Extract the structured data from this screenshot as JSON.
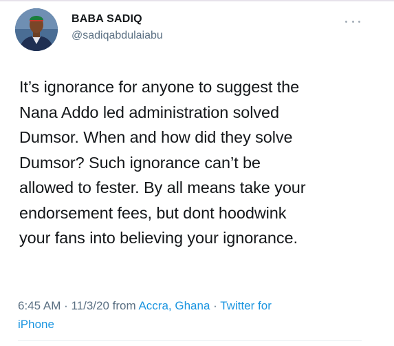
{
  "user": {
    "display_name": "BABA SADIQ",
    "handle": "@sadiqabdulaiabu",
    "avatar_icon": "profile-photo"
  },
  "menu_icon": "more-horizontal-icon",
  "tweet": {
    "lines": [
      "It’s ignorance for anyone to suggest the",
      "Nana Addo led administration solved",
      "Dumsor. When and how did they solve",
      "Dumsor? Such ignorance can’t be",
      "allowed to fester. By all means take your",
      "endorsement fees, but dont hoodwink",
      "your fans into believing your ignorance."
    ]
  },
  "meta": {
    "time": "6:45 AM",
    "separator1": " · ",
    "date": "11/3/20",
    "from_text": " from ",
    "location": "Accra, Ghana",
    "separator2": " · ",
    "source_part1": "Twitter for",
    "source_part2": "iPhone"
  },
  "colors": {
    "link": "#1b95e0",
    "secondary_text": "#5b7083",
    "primary_text": "#14171a"
  }
}
